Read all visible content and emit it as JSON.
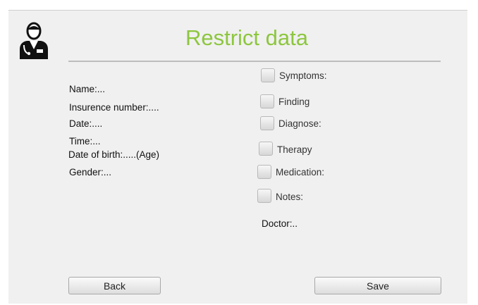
{
  "title": "Restrict data",
  "patient_info": [
    "Name:...",
    "Insurence number:....",
    "Date:....",
    "Time:...",
    "Date of birth:.....(Age)",
    "Gender:..."
  ],
  "checkboxes": [
    {
      "label": "Symptoms:",
      "checked": false
    },
    {
      "label": "Finding",
      "checked": false
    },
    {
      "label": "Diagnose:",
      "checked": false
    },
    {
      "label": "Therapy",
      "checked": false
    },
    {
      "label": "Medication:",
      "checked": false
    },
    {
      "label": "Notes:",
      "checked": false
    }
  ],
  "doctor_label": "Doctor:..",
  "buttons": {
    "back": "Back",
    "save": "Save"
  },
  "colors": {
    "title": "#8dc63f"
  },
  "icon": "doctor-icon"
}
